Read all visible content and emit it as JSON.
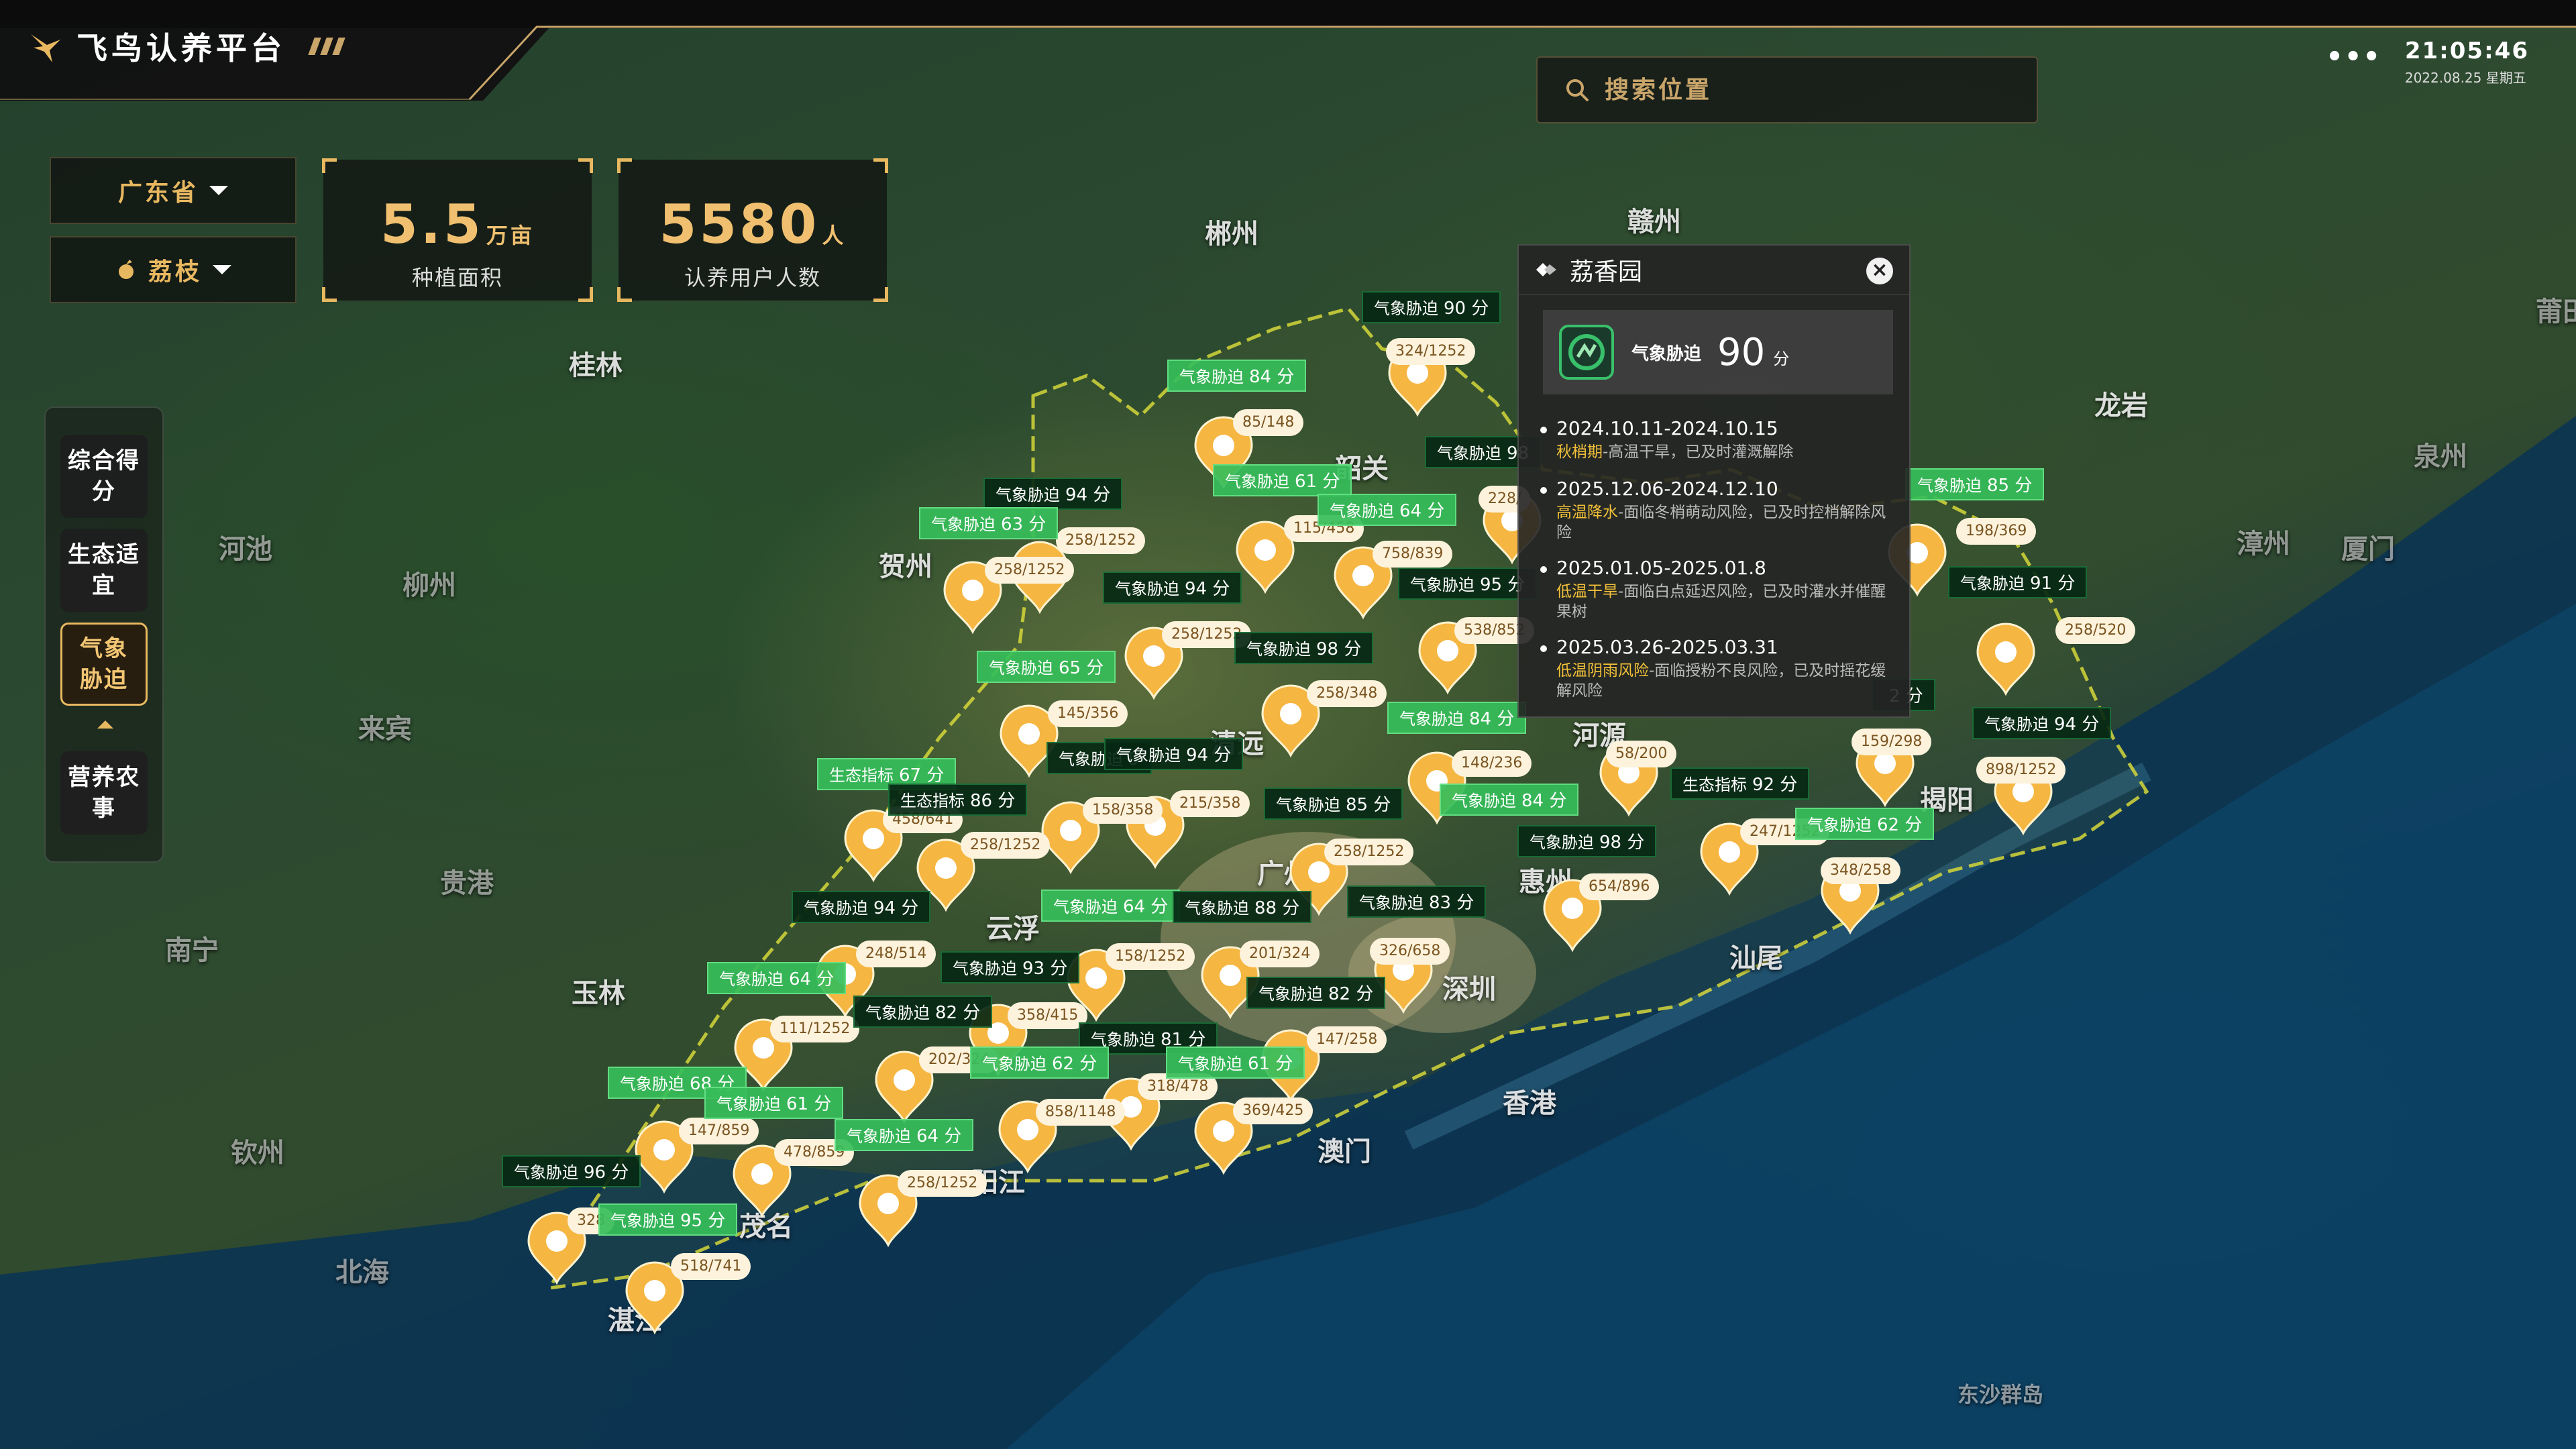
{
  "app": {
    "title": "飞鸟认养平台"
  },
  "clock": {
    "time": "21:05:46",
    "date": "2022.08.25 星期五"
  },
  "search": {
    "placeholder": "搜索位置"
  },
  "filters": {
    "province": "广东省",
    "crop": "荔枝"
  },
  "stats": [
    {
      "value": "5.5",
      "unit": "万亩",
      "label": "种植面积"
    },
    {
      "value": "5580",
      "unit": "人",
      "label": "认养用户人数"
    }
  ],
  "menu": [
    {
      "label": "综合得分",
      "active": false
    },
    {
      "label": "生态适宜",
      "active": false
    },
    {
      "label": "气象胁迫",
      "active": true
    },
    {
      "label": "营养农事",
      "active": false
    }
  ],
  "colors": {
    "accent": "#e8b860",
    "tag_dark": "#06281a",
    "tag_bright": "#36be5a",
    "pin": "#f5b642",
    "highlight": "#f3c13a"
  },
  "cities": [
    {
      "name": "郴州"
    },
    {
      "name": "赣州"
    },
    {
      "name": "柳州"
    },
    {
      "name": "桂林"
    },
    {
      "name": "河池"
    },
    {
      "name": "贺州"
    },
    {
      "name": "韶关"
    },
    {
      "name": "龙岩"
    },
    {
      "name": "泉州"
    },
    {
      "name": "莆田"
    },
    {
      "name": "漳州"
    },
    {
      "name": "厦门"
    },
    {
      "name": "来宾"
    },
    {
      "name": "清远"
    },
    {
      "name": "河源"
    },
    {
      "name": "揭阳"
    },
    {
      "name": "贵港"
    },
    {
      "name": "云浮"
    },
    {
      "name": "广州"
    },
    {
      "name": "惠州"
    },
    {
      "name": "南宁"
    },
    {
      "name": "玉林"
    },
    {
      "name": "深圳"
    },
    {
      "name": "汕尾"
    },
    {
      "name": "香港"
    },
    {
      "name": "钦州"
    },
    {
      "name": "澳门"
    },
    {
      "name": "阳江"
    },
    {
      "name": "茂名"
    },
    {
      "name": "北海"
    },
    {
      "name": "湛江"
    },
    {
      "name": "东沙群岛"
    }
  ],
  "markers": {
    "tags": [
      {
        "label": "气象胁迫",
        "score": "90 分",
        "style": "dark"
      },
      {
        "label": "气象胁迫",
        "score": "84 分",
        "style": "bright"
      },
      {
        "label": "气象胁迫",
        "score": "98",
        "style": "dark"
      },
      {
        "label": "气象胁迫",
        "score": "61 分",
        "style": "bright"
      },
      {
        "label": "气象胁迫",
        "score": "64 分",
        "style": "bright"
      },
      {
        "label": "气象胁迫",
        "score": "94 分",
        "style": "dark"
      },
      {
        "label": "气象胁迫",
        "score": "63 分",
        "style": "bright"
      },
      {
        "label": "气象胁迫",
        "score": "94 分",
        "style": "dark"
      },
      {
        "label": "气象胁迫",
        "score": "95 分",
        "style": "dark"
      },
      {
        "label": "气象胁迫",
        "score": "65 分",
        "style": "bright"
      },
      {
        "label": "气象胁迫",
        "score": "98 分",
        "style": "dark"
      },
      {
        "label": "气象胁迫",
        "score": "84 分",
        "style": "bright"
      },
      {
        "label": "气象胁迫",
        "score": "9",
        "style": "dark"
      },
      {
        "label": "气象胁迫",
        "score": "94 分",
        "style": "dark"
      },
      {
        "label": "生态指标",
        "score": "67 分",
        "style": "bright"
      },
      {
        "label": "生态指标",
        "score": "86 分",
        "style": "dark"
      },
      {
        "label": "气象胁迫",
        "score": "85 分",
        "style": "dark"
      },
      {
        "label": "气象胁迫",
        "score": "84 分",
        "style": "bright"
      },
      {
        "label": "生态指标",
        "score": "92 分",
        "style": "dark"
      },
      {
        "label": "气象胁迫",
        "score": "98 分",
        "style": "dark"
      },
      {
        "label": "气象胁迫",
        "score": "62 分",
        "style": "bright"
      },
      {
        "label": "气象胁迫",
        "score": "94 分",
        "style": "dark"
      },
      {
        "label": "气象胁迫",
        "score": "64 分",
        "style": "bright"
      },
      {
        "label": "气象胁迫",
        "score": "88 分",
        "style": "dark"
      },
      {
        "label": "气象胁迫",
        "score": "83 分",
        "style": "dark"
      },
      {
        "label": "气象胁迫",
        "score": "93 分",
        "style": "dark"
      },
      {
        "label": "气象胁迫",
        "score": "64 分",
        "style": "bright"
      },
      {
        "label": "气象胁迫",
        "score": "82 分",
        "style": "dark"
      },
      {
        "label": "气象胁迫",
        "score": "82 分",
        "style": "dark"
      },
      {
        "label": "气象胁迫",
        "score": "81 分",
        "style": "dark"
      },
      {
        "label": "气象胁迫",
        "score": "68 分",
        "style": "bright"
      },
      {
        "label": "气象胁迫",
        "score": "61 分",
        "style": "bright"
      },
      {
        "label": "气象胁迫",
        "score": "62 分",
        "style": "bright"
      },
      {
        "label": "气象胁迫",
        "score": "61 分",
        "style": "bright"
      },
      {
        "label": "气象胁迫",
        "score": "64 分",
        "style": "bright"
      },
      {
        "label": "气象胁迫",
        "score": "96 分",
        "style": "dark"
      },
      {
        "label": "气象胁迫",
        "score": "95 分",
        "style": "bright"
      },
      {
        "label": "气象胁迫",
        "score": "85 分",
        "style": "bright"
      },
      {
        "label": "气象胁迫",
        "score": "91 分",
        "style": "dark"
      },
      {
        "label": "气象胁迫",
        "score": "94 分",
        "style": "dark"
      },
      {
        "label": "",
        "score": "2 分",
        "style": "dark"
      }
    ],
    "counts": [
      "324/1252",
      "85/148",
      "228/",
      "115/458",
      "758/839",
      "258/1252",
      "258/1252",
      "258/1252",
      "538/852",
      "258/348",
      "145/356",
      "148/236",
      "58/200",
      "159/298",
      "898/1252",
      "458/641",
      "258/1252",
      "158/358",
      "215/358",
      "258/1252",
      "247/1252",
      "348/258",
      "654/896",
      "248/514",
      "158/1252",
      "201/324",
      "326/658",
      "111/1252",
      "358/415",
      "202/324",
      "147/258",
      "318/478",
      "858/1148",
      "369/425",
      "147/859",
      "478/859",
      "258/1252",
      "328",
      "518/741",
      "198/369",
      "258/520"
    ]
  },
  "popup": {
    "title": "荔香园",
    "metric": {
      "label": "气象胁迫",
      "value": "90",
      "unit": "分"
    },
    "events": [
      {
        "date": "2024.10.11-2024.10.15",
        "stage": "秋梢期",
        "text": "-高温干旱，已及时灌溉解除"
      },
      {
        "date": "2025.12.06-2024.12.10",
        "stage": "高温降水",
        "text": "-面临冬梢萌动风险，已及时控梢解除风险"
      },
      {
        "date": "2025.01.05-2025.01.8",
        "stage": "低温干旱",
        "text": "-面临白点延迟风险，已及时灌水并催醒果树"
      },
      {
        "date": "2025.03.26-2025.03.31",
        "stage": "低温阴雨风险",
        "text": "-面临授粉不良风险，已及时摇花缓解风险"
      }
    ]
  }
}
